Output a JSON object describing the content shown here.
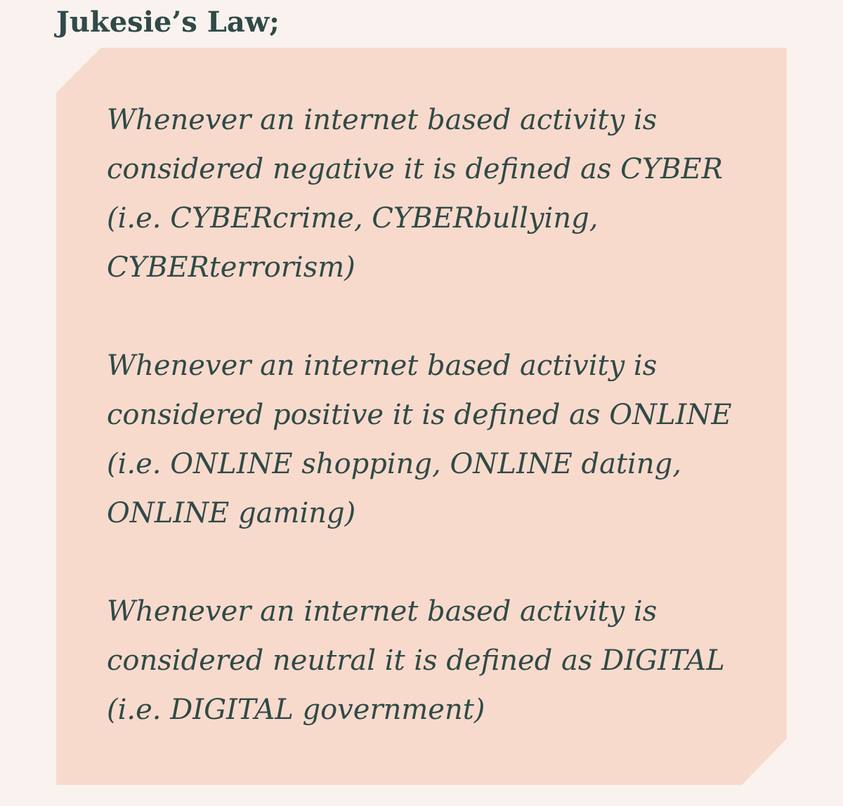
{
  "heading": "Jukesie’s Law;",
  "quote": {
    "paragraphs": [
      "Whenever an internet based activity is considered negative it is defined as CYBER (i.e. CYBERcrime, CYBERbullying, CYBERterrorism)",
      "Whenever an internet based activity is considered positive it is defined as ONLINE (i.e. ONLINE shopping, ONLINE dating, ONLINE gaming)",
      "Whenever an internet based activity is considered neutral it is defined as DIGITAL (i.e. DIGITAL government)"
    ]
  },
  "colors": {
    "page_background": "#f9f2ef",
    "quote_background": "#f8dacc",
    "text": "#2f4a47"
  }
}
